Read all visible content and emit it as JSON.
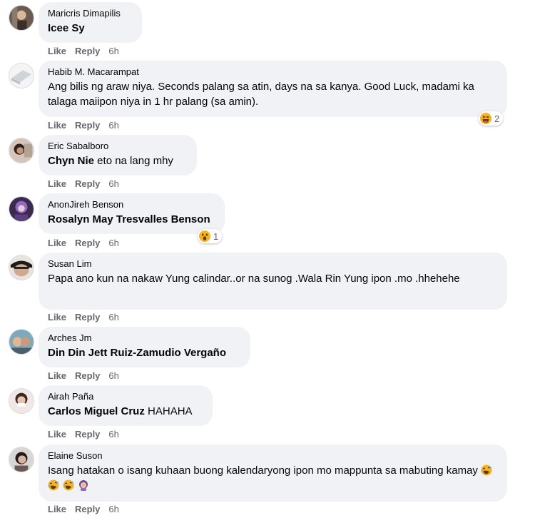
{
  "comments": [
    {
      "author": "Maricris Dimapilis",
      "tag": "Icee Sy",
      "text": "",
      "like": "Like",
      "reply": "Reply",
      "time": "6h"
    },
    {
      "author": "Habib M. Macarampat",
      "tag": "",
      "text": "Ang bilis ng araw niya. Seconds palang sa atin, days na sa kanya. Good Luck, madami ka talaga maiipon niya in 1 hr palang (sa amin).",
      "like": "Like",
      "reply": "Reply",
      "time": "6h",
      "reaction_count": "2",
      "reaction_icon": "haha-emoji-icon"
    },
    {
      "author": "Eric Sabalboro",
      "tag": "Chyn Nie",
      "text": " eto na lang mhy",
      "like": "Like",
      "reply": "Reply",
      "time": "6h"
    },
    {
      "author": "AnonJireh Benson",
      "tag": "Rosalyn May Tresvalles Benson",
      "text": "",
      "like": "Like",
      "reply": "Reply",
      "time": "6h",
      "reaction_count": "1",
      "reaction_icon": "wow-emoji-icon"
    },
    {
      "author": "Susan Lim",
      "tag": "",
      "text": "Papa ano kun na nakaw Yung calindar..or na sunog .Wala Rin Yung ipon .mo .hhehehe",
      "like": "Like",
      "reply": "Reply",
      "time": "6h"
    },
    {
      "author": "Arches Jm",
      "tag": "Din Din Jett Ruiz-Zamudio Vergaño",
      "text": "",
      "like": "Like",
      "reply": "Reply",
      "time": "6h"
    },
    {
      "author": "Airah Paña",
      "tag": "Carlos Miguel Cruz",
      "text": " HAHAHA",
      "like": "Like",
      "reply": "Reply",
      "time": "6h"
    },
    {
      "author": "Elaine Suson",
      "tag": "",
      "text": "Isang hatakan o isang kuhaan buong kalendaryong ipon mo mappunta sa mabuting kamay",
      "like": "Like",
      "reply": "Reply",
      "time": "6h",
      "emojis": [
        "rofl-emoji-icon",
        "rofl-emoji-icon",
        "rofl-emoji-icon",
        "woman-facepalming-emoji-icon"
      ]
    }
  ],
  "colors": {
    "bubble": "#f0f2f5",
    "meta": "#65676b",
    "text": "#050505"
  }
}
